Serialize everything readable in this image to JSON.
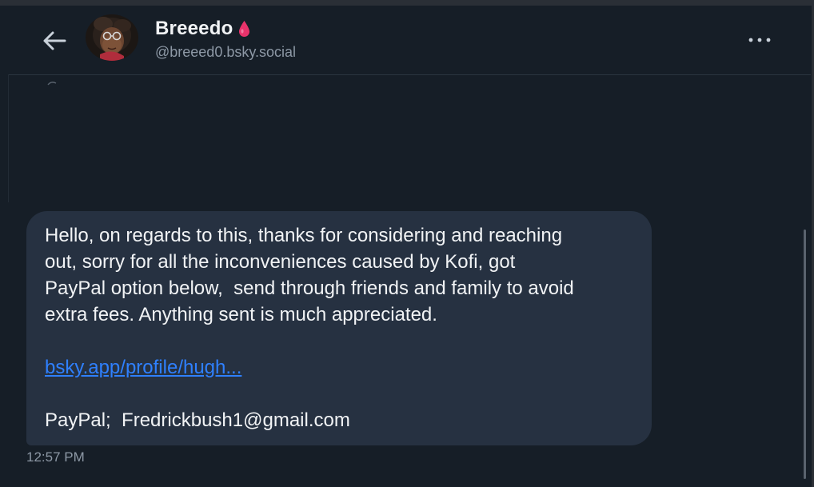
{
  "header": {
    "back_icon": "arrow-left-icon",
    "display_name": "Breeedo",
    "badge_icon": "pink-drop-icon",
    "badge_color": "#e8336b",
    "handle": "@breeed0.bsky.social",
    "more_icon": "more-horizontal-icon"
  },
  "message": {
    "text": "Hello, on regards to this, thanks for considering and reaching\nout, sorry for all the inconveniences caused by Kofi, got\nPayPal option below,  send through friends and family to avoid\nextra fees. Anything sent is much appreciated.",
    "link": "bsky.app/profile/hugh...",
    "paypal_line": "PayPal;  Fredrickbush1@gmail.com",
    "timestamp": "12:57 PM",
    "link_color": "#2f80ff",
    "bubble_color": "#263141"
  }
}
